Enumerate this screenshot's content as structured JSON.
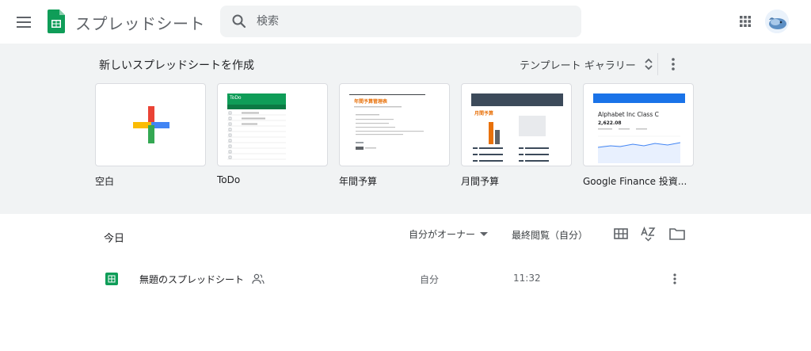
{
  "header": {
    "app_title": "スプレッドシート",
    "search_placeholder": "検索"
  },
  "gallery": {
    "heading": "新しいスプレッドシートを作成",
    "toggle_label": "テンプレート ギャラリー",
    "templates": [
      {
        "label": "空白"
      },
      {
        "label": "ToDo",
        "thumb_title": "ToDo"
      },
      {
        "label": "年間予算",
        "thumb_title": "年間予算管理表"
      },
      {
        "label": "月間予算",
        "thumb_title": "月間予算"
      },
      {
        "label": "Google Finance 投資...",
        "thumb_title": "Alphabet Inc Class C",
        "thumb_value": "2,622.08"
      }
    ]
  },
  "files": {
    "section_label": "今日",
    "owner_filter": "自分がオーナー",
    "sort_label": "最終閲覧（自分）",
    "rows": [
      {
        "name": "無題のスプレッドシート",
        "owner": "自分",
        "time": "11:32"
      }
    ]
  },
  "colors": {
    "sheets_green": "#0f9d58",
    "google_red": "#ea4335",
    "google_blue": "#4285f4",
    "google_yellow": "#fbbc04",
    "google_green": "#34a853"
  }
}
